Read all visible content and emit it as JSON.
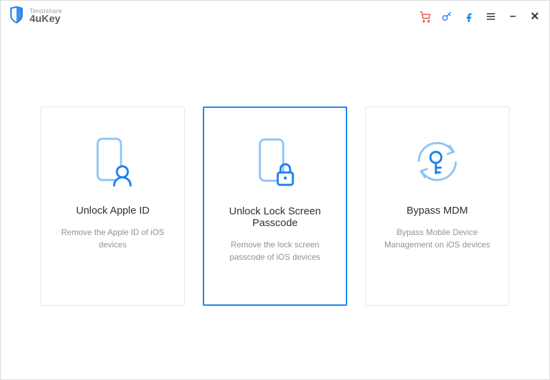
{
  "app": {
    "company": "Tenorshare",
    "product": "4uKey"
  },
  "toolbar": {
    "cart": "cart-icon",
    "key": "key-icon",
    "facebook": "facebook-icon",
    "menu": "menu-icon",
    "minimize": "–",
    "close": "✕"
  },
  "cards": [
    {
      "title": "Unlock Apple ID",
      "desc": "Remove the Apple ID of iOS devices",
      "selected": false,
      "icon": "phone-user"
    },
    {
      "title": "Unlock Lock Screen Passcode",
      "desc": "Remove the lock screen passcode of iOS devices",
      "selected": true,
      "icon": "phone-lock"
    },
    {
      "title": "Bypass MDM",
      "desc": "Bypass Mobile Device Management on iOS devices",
      "selected": false,
      "icon": "sync-key"
    }
  ]
}
